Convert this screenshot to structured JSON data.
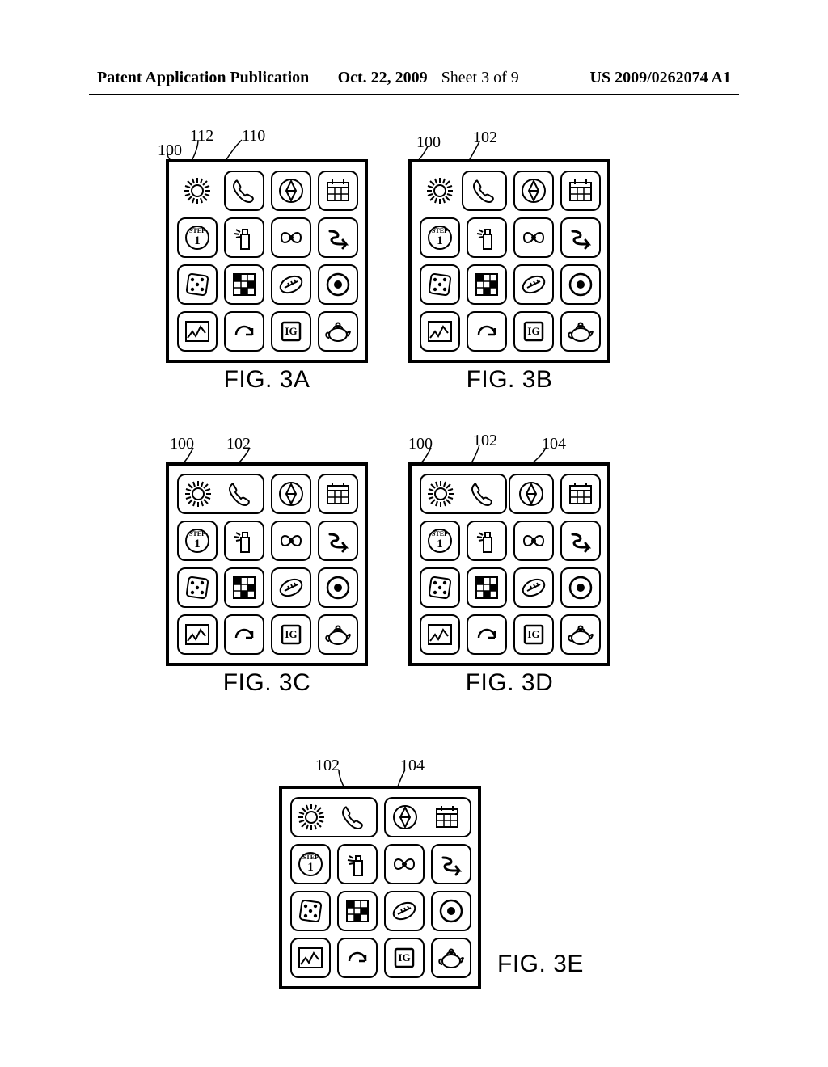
{
  "header": {
    "publication_label": "Patent Application Publication",
    "date": "Oct. 22, 2009",
    "sheet": "Sheet 3 of 9",
    "pub_no": "US 2009/0262074 A1"
  },
  "refs": {
    "r100": "100",
    "r102": "102",
    "r104": "104",
    "r110": "110",
    "r112": "112"
  },
  "figures": {
    "a": {
      "caption": "FIG. 3A"
    },
    "b": {
      "caption": "FIG. 3B"
    },
    "c": {
      "caption": "FIG. 3C"
    },
    "d": {
      "caption": "FIG. 3D"
    },
    "e": {
      "caption": "FIG. 3E"
    }
  },
  "icons": {
    "sun": "sunflower-icon",
    "phone": "phone-icon",
    "compass": "compass-icon",
    "calendar": "calendar-icon",
    "step1": "step1-icon",
    "spray": "spray-icon",
    "bow": "bow-icon",
    "sarrow": "s-arrow-icon",
    "dice": "dice-icon",
    "crossword": "crossword-icon",
    "football": "football-icon",
    "record": "record-icon",
    "chart": "chart-icon",
    "redo": "redo-icon",
    "ig": "ig-icon",
    "teapot": "teapot-icon"
  },
  "icon_text": {
    "step1_top": "STEP",
    "step1_bottom": "1",
    "ig": "IG"
  }
}
